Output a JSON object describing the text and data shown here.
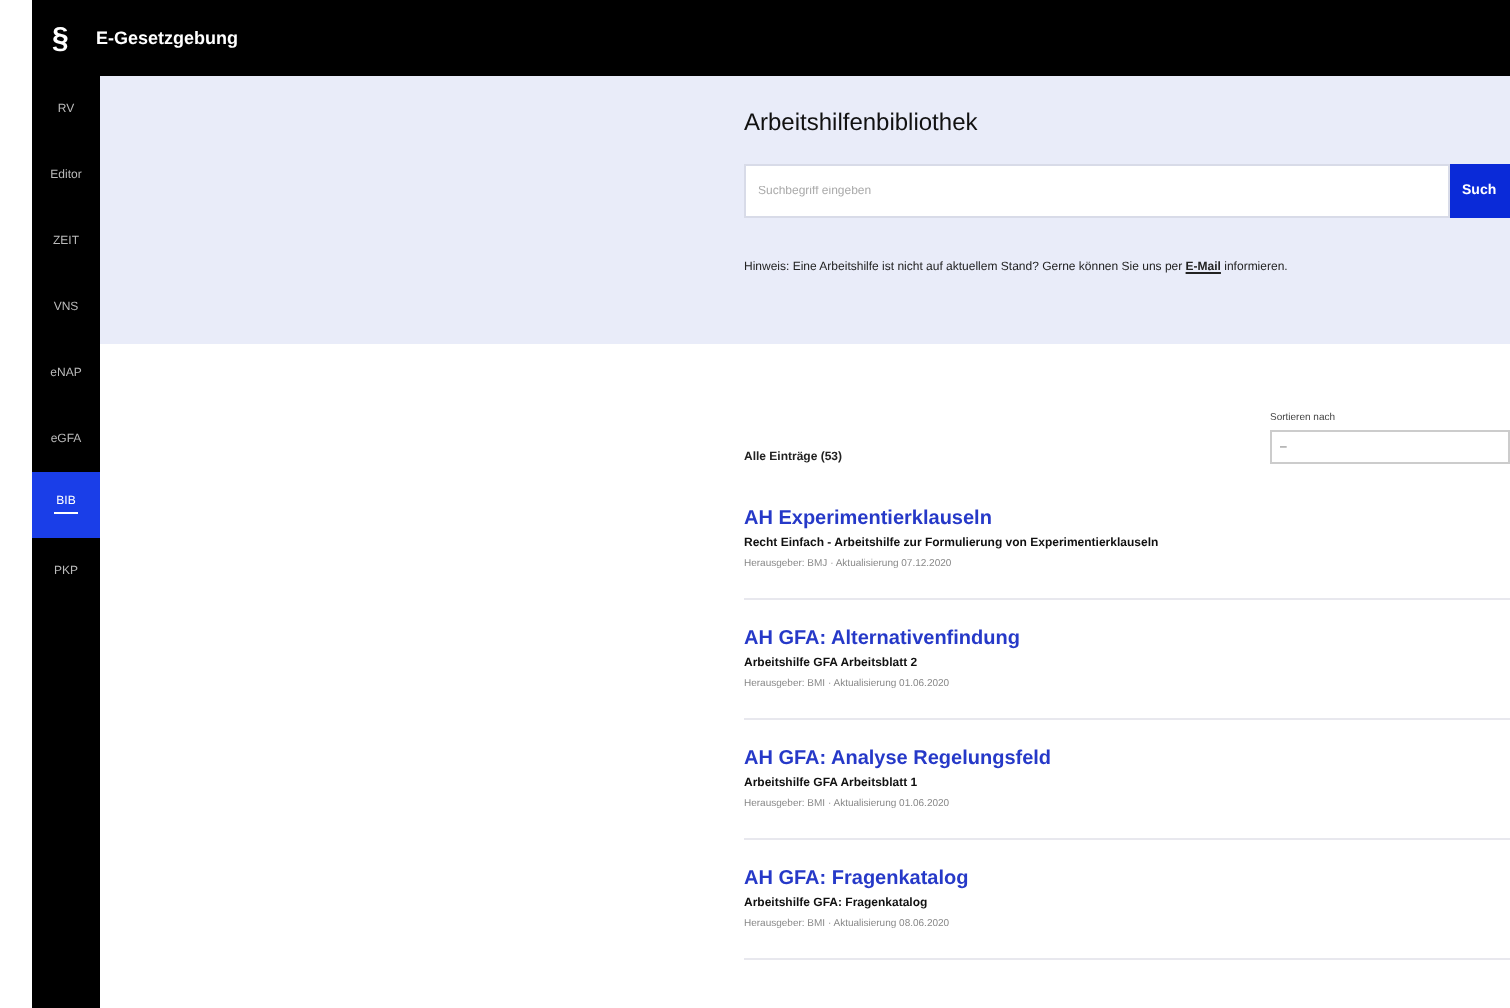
{
  "header": {
    "logo": "§",
    "title": "E-Gesetzgebung"
  },
  "sidebar": {
    "items": [
      {
        "label": "RV",
        "selected": false
      },
      {
        "label": "Editor",
        "selected": false
      },
      {
        "label": "ZEIT",
        "selected": false
      },
      {
        "label": "VNS",
        "selected": false
      },
      {
        "label": "eNAP",
        "selected": false
      },
      {
        "label": "eGFA",
        "selected": false
      },
      {
        "label": "BIB",
        "selected": true
      },
      {
        "label": "PKP",
        "selected": false
      }
    ]
  },
  "library": {
    "title": "Arbeitshilfenbibliothek",
    "search": {
      "placeholder": "Suchbegriff eingeben",
      "button": "Such"
    },
    "hint": "Hinweis: Eine Arbeitshilfe ist nicht auf aktuellem Stand? Gerne können Sie uns per",
    "hint_link": "E-Mail",
    "hint_end": "informieren."
  },
  "list": {
    "count": "Alle Einträge (53)",
    "sort_label": "Sortieren nach",
    "sort_value": "–",
    "entries": [
      {
        "title": "AH Experimentierklauseln",
        "subtitle": "Recht Einfach - Arbeitshilfe zur Formulierung von Experimentierklauseln",
        "meta": "Herausgeber: BMJ · Aktualisierung 07.12.2020"
      },
      {
        "title": "AH GFA: Alternativenfindung",
        "subtitle": "Arbeitshilfe GFA Arbeitsblatt 2",
        "meta": "Herausgeber: BMI · Aktualisierung 01.06.2020"
      },
      {
        "title": "AH GFA: Analyse Regelungsfeld",
        "subtitle": "Arbeitshilfe GFA Arbeitsblatt 1",
        "meta": "Herausgeber: BMI · Aktualisierung 01.06.2020"
      },
      {
        "title": "AH GFA: Fragenkatalog",
        "subtitle": "Arbeitshilfe GFA: Fragenkatalog",
        "meta": "Herausgeber: BMI · Aktualisierung 08.06.2020"
      }
    ]
  }
}
